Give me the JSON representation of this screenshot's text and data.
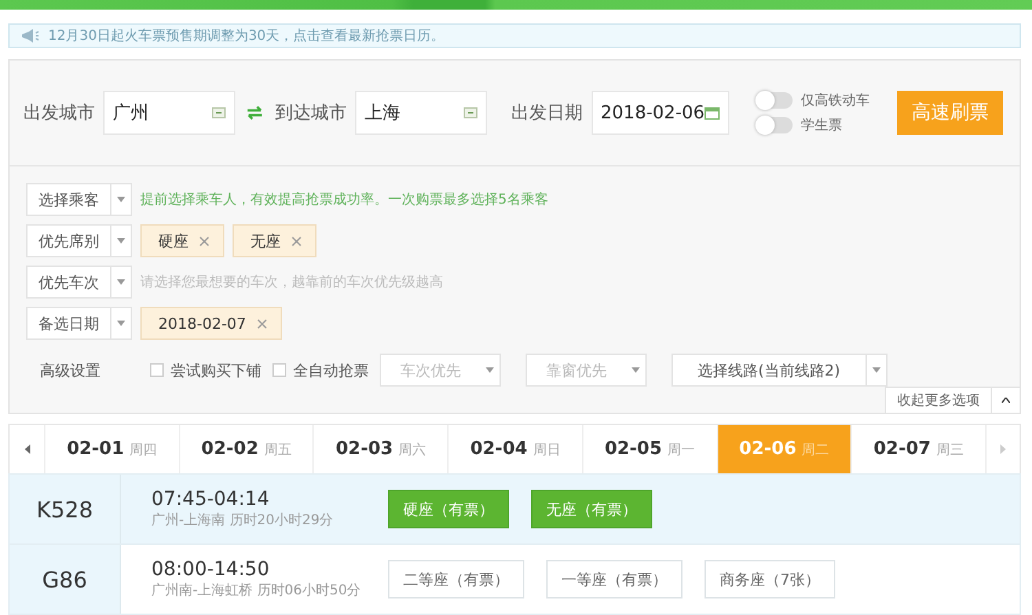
{
  "notice": {
    "text": "12月30日起火车票预售期调整为30天，点击查看最新抢票日历。"
  },
  "search": {
    "from": {
      "label": "出发城市",
      "value": "广州"
    },
    "to": {
      "label": "到达城市",
      "value": "上海"
    },
    "date": {
      "label": "出发日期",
      "value": "2018-02-06"
    },
    "toggles": [
      {
        "label": "仅高铁动车",
        "on": false
      },
      {
        "label": "学生票",
        "on": false
      }
    ],
    "submit": "高速刷票"
  },
  "options": {
    "rows": [
      {
        "label": "选择乘客",
        "kind": "hint",
        "highlighted": true,
        "hint": "提前选择乘车人，有效提高抢票成功率。一次购票最多选择5名乘客"
      },
      {
        "label": "优先席别",
        "kind": "tags",
        "tags": [
          "硬座",
          "无座"
        ]
      },
      {
        "label": "优先车次",
        "kind": "hint",
        "highlighted": false,
        "hint": "请选择您最想要的车次，越靠前的车次优先级越高"
      },
      {
        "label": "备选日期",
        "kind": "tags",
        "tags": [
          "2018-02-07"
        ]
      }
    ],
    "advanced": {
      "label": "高级设置",
      "checkboxes": [
        {
          "label": "尝试购买下铺",
          "checked": false
        },
        {
          "label": "全自动抢票",
          "checked": false
        }
      ],
      "selects": [
        {
          "value": "车次优先",
          "disabled": true
        },
        {
          "value": "靠窗优先",
          "disabled": true
        }
      ],
      "route": "选择线路(当前线路2)"
    },
    "collapse": "收起更多选项"
  },
  "dates": [
    {
      "date": "02-01",
      "weekday": "周四",
      "selected": false
    },
    {
      "date": "02-02",
      "weekday": "周五",
      "selected": false
    },
    {
      "date": "02-03",
      "weekday": "周六",
      "selected": false
    },
    {
      "date": "02-04",
      "weekday": "周日",
      "selected": false
    },
    {
      "date": "02-05",
      "weekday": "周一",
      "selected": false
    },
    {
      "date": "02-06",
      "weekday": "周二",
      "selected": true
    },
    {
      "date": "02-07",
      "weekday": "周三",
      "selected": false
    }
  ],
  "trains": [
    {
      "number": "K528",
      "times": "07:45-04:14",
      "route": "广州-上海南 历时20小时29分",
      "selected": true,
      "seats": [
        {
          "label": "硬座（有票）",
          "kind": "primary"
        },
        {
          "label": "无座（有票）",
          "kind": "primary"
        }
      ]
    },
    {
      "number": "G86",
      "times": "08:00-14:50",
      "route": "广州南-上海虹桥 历时06小时50分",
      "selected": false,
      "seats": [
        {
          "label": "二等座（有票）",
          "kind": "default"
        },
        {
          "label": "一等座（有票）",
          "kind": "default"
        },
        {
          "label": "商务座（7张）",
          "kind": "default"
        }
      ]
    }
  ]
}
